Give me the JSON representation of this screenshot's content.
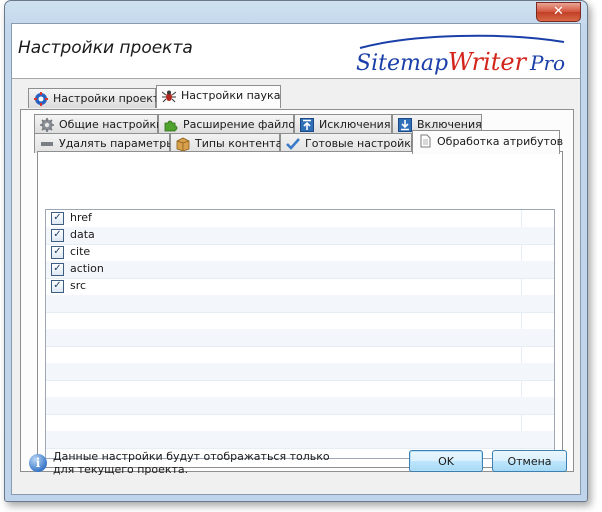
{
  "window": {
    "close_symbol": "✕"
  },
  "header": {
    "title": "Настройки проекта",
    "logo": {
      "part1": "Sitemap",
      "part2": "Writer",
      "part3": "Pro"
    }
  },
  "top_tabs": [
    {
      "label": "Настройки проекта",
      "icon": "gear-blue-icon",
      "active": false
    },
    {
      "label": "Настройки паука",
      "icon": "spider-icon",
      "active": true
    }
  ],
  "sub_tabs_row1": [
    {
      "label": "Общие настройки",
      "icon": "gear-icon"
    },
    {
      "label": "Расширение файлов",
      "icon": "puzzle-icon"
    },
    {
      "label": "Исключения",
      "icon": "exclude-icon"
    },
    {
      "label": "Включения",
      "icon": "include-icon"
    }
  ],
  "sub_tabs_row2": [
    {
      "label": "Удалять параметры",
      "icon": "minus-icon"
    },
    {
      "label": "Типы контента",
      "icon": "box-icon"
    },
    {
      "label": "Готовые настройки",
      "icon": "check-icon"
    },
    {
      "label": "Обработка атрибутов",
      "icon": "document-icon",
      "active": true
    }
  ],
  "attributes": [
    {
      "name": "href",
      "checked": true
    },
    {
      "name": "data",
      "checked": true
    },
    {
      "name": "cite",
      "checked": true
    },
    {
      "name": "action",
      "checked": true
    },
    {
      "name": "src",
      "checked": true
    }
  ],
  "footer": {
    "info": "Данные настройки будут отображаться только для текущего проекта.",
    "ok": "OK",
    "cancel": "Отмена"
  },
  "colors": {
    "logo_blue": "#1a3fa8",
    "logo_red": "#d3241b"
  }
}
